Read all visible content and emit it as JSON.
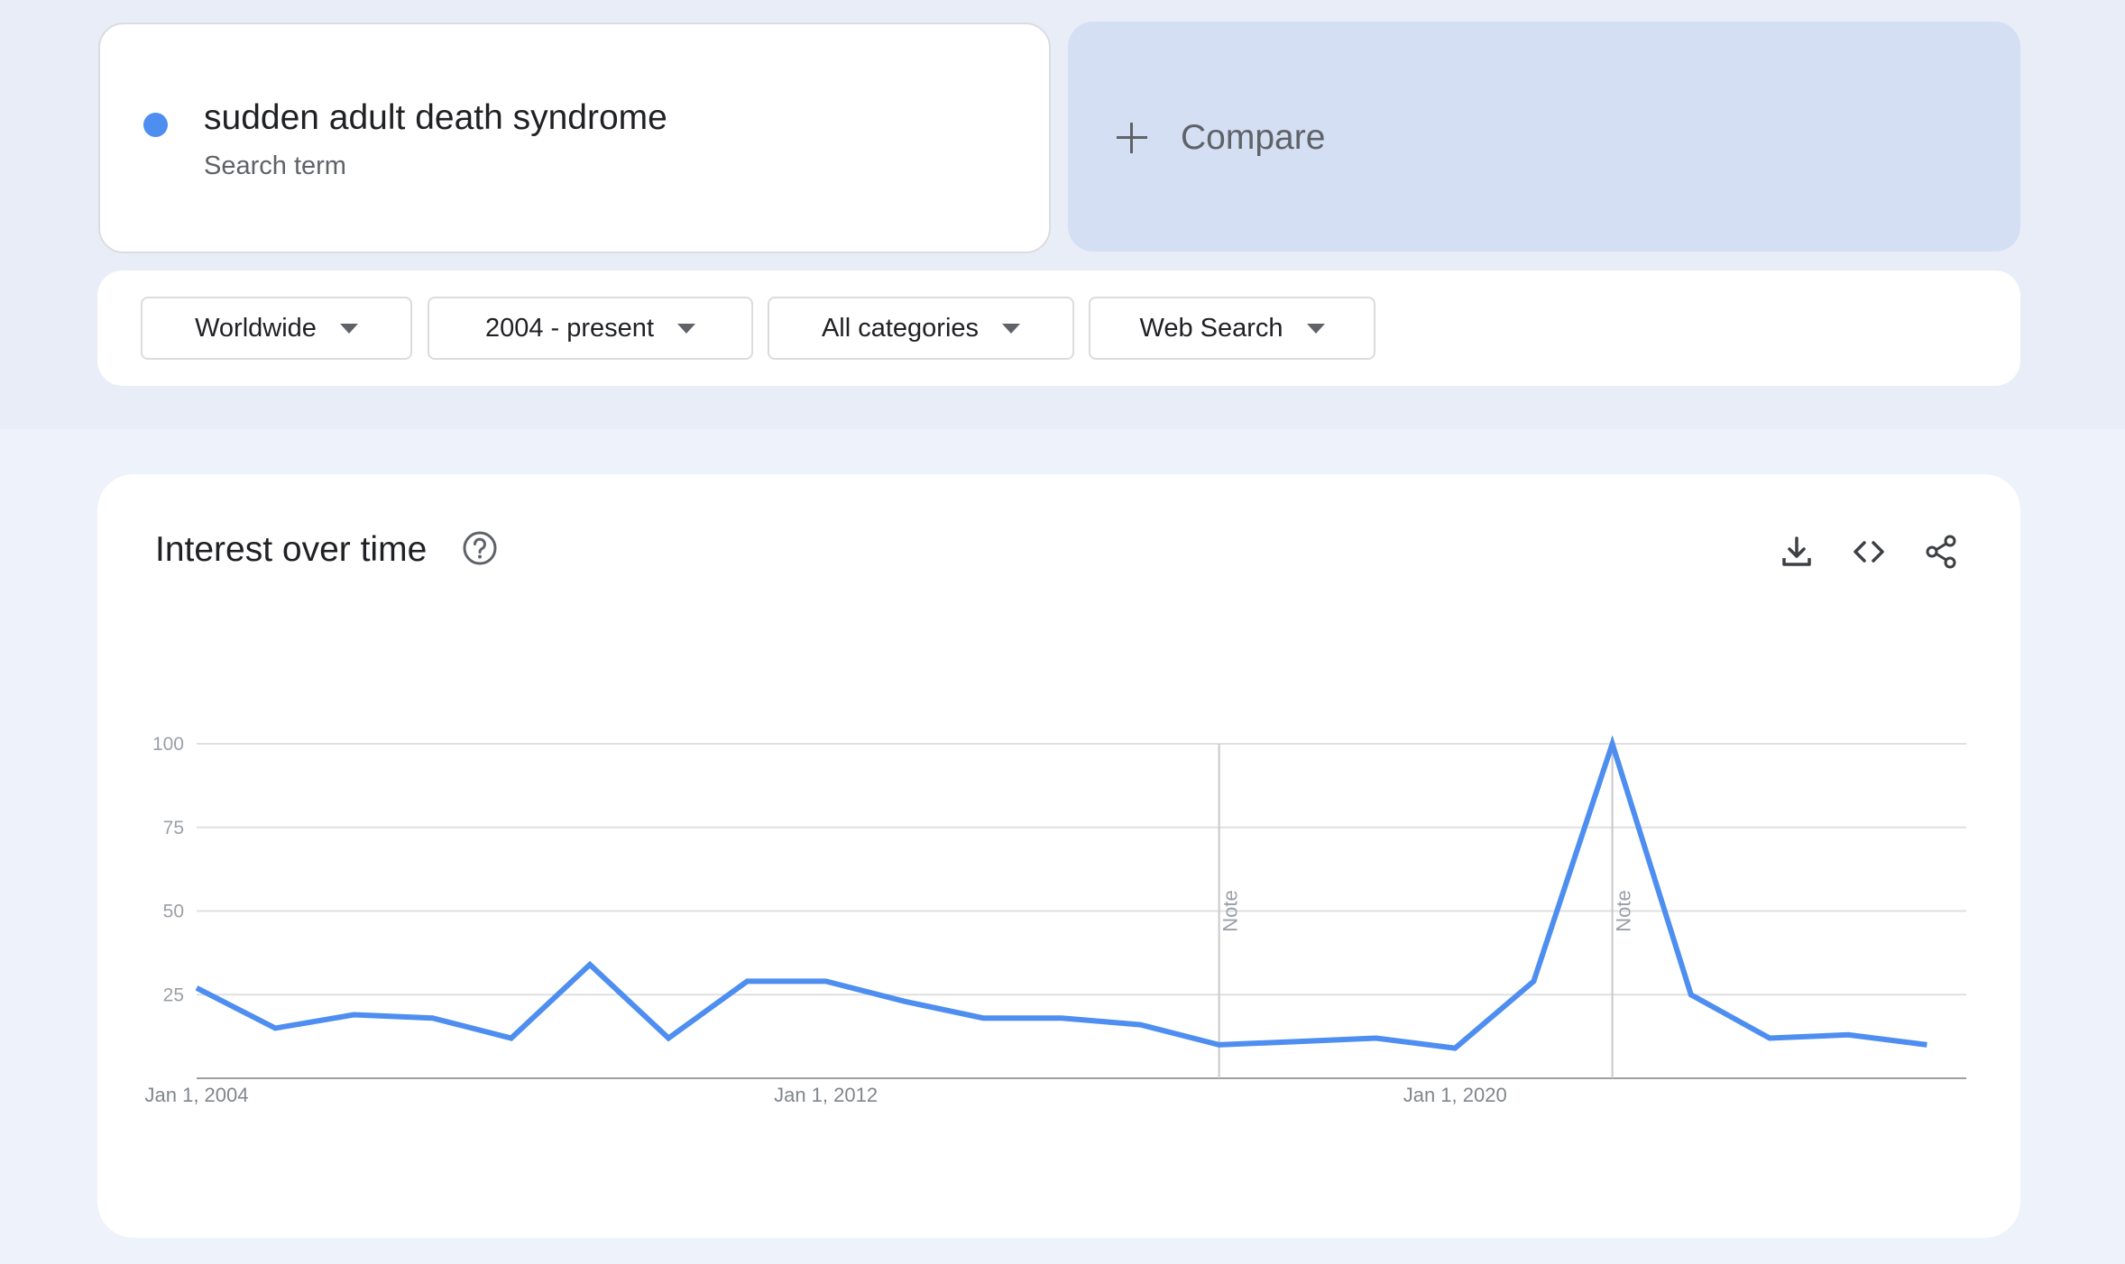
{
  "search_term": {
    "name": "sudden adult death syndrome",
    "subtitle": "Search term",
    "dot_color": "#4d8ef0"
  },
  "compare": {
    "label": "Compare",
    "icon": "plus-icon"
  },
  "filters": [
    {
      "label": "Worldwide",
      "icon": "caret-down-icon"
    },
    {
      "label": "2004 - present",
      "icon": "caret-down-icon"
    },
    {
      "label": "All categories",
      "icon": "caret-down-icon"
    },
    {
      "label": "Web Search",
      "icon": "caret-down-icon"
    }
  ],
  "interest_card": {
    "title": "Interest over time",
    "help_icon": "help-circle-icon",
    "actions": [
      "download-icon",
      "embed-code-icon",
      "share-icon"
    ]
  },
  "chart_data": {
    "type": "line",
    "ylim": [
      0,
      100
    ],
    "yticks": [
      100,
      75,
      50,
      25
    ],
    "xticks": [
      {
        "label": "Jan 1, 2004",
        "x": 2004
      },
      {
        "label": "Jan 1, 2012",
        "x": 2012
      },
      {
        "label": "Jan 1, 2020",
        "x": 2020
      }
    ],
    "grid": true,
    "line_color": "#4d8ef0",
    "series": [
      {
        "x": [
          2004,
          2005,
          2006,
          2007,
          2008,
          2009,
          2010,
          2011,
          2012,
          2013,
          2014,
          2015,
          2016,
          2017,
          2018,
          2019,
          2020,
          2021,
          2022,
          2023,
          2024,
          2025,
          2026
        ],
        "values": [
          27,
          15,
          19,
          18,
          12,
          34,
          12,
          29,
          29,
          23,
          18,
          18,
          16,
          10,
          11,
          12,
          9,
          29,
          100,
          25,
          12,
          13,
          10
        ]
      }
    ],
    "annotations": [
      {
        "label": "Note",
        "x": 2017
      },
      {
        "label": "Note",
        "x": 2022
      }
    ]
  }
}
